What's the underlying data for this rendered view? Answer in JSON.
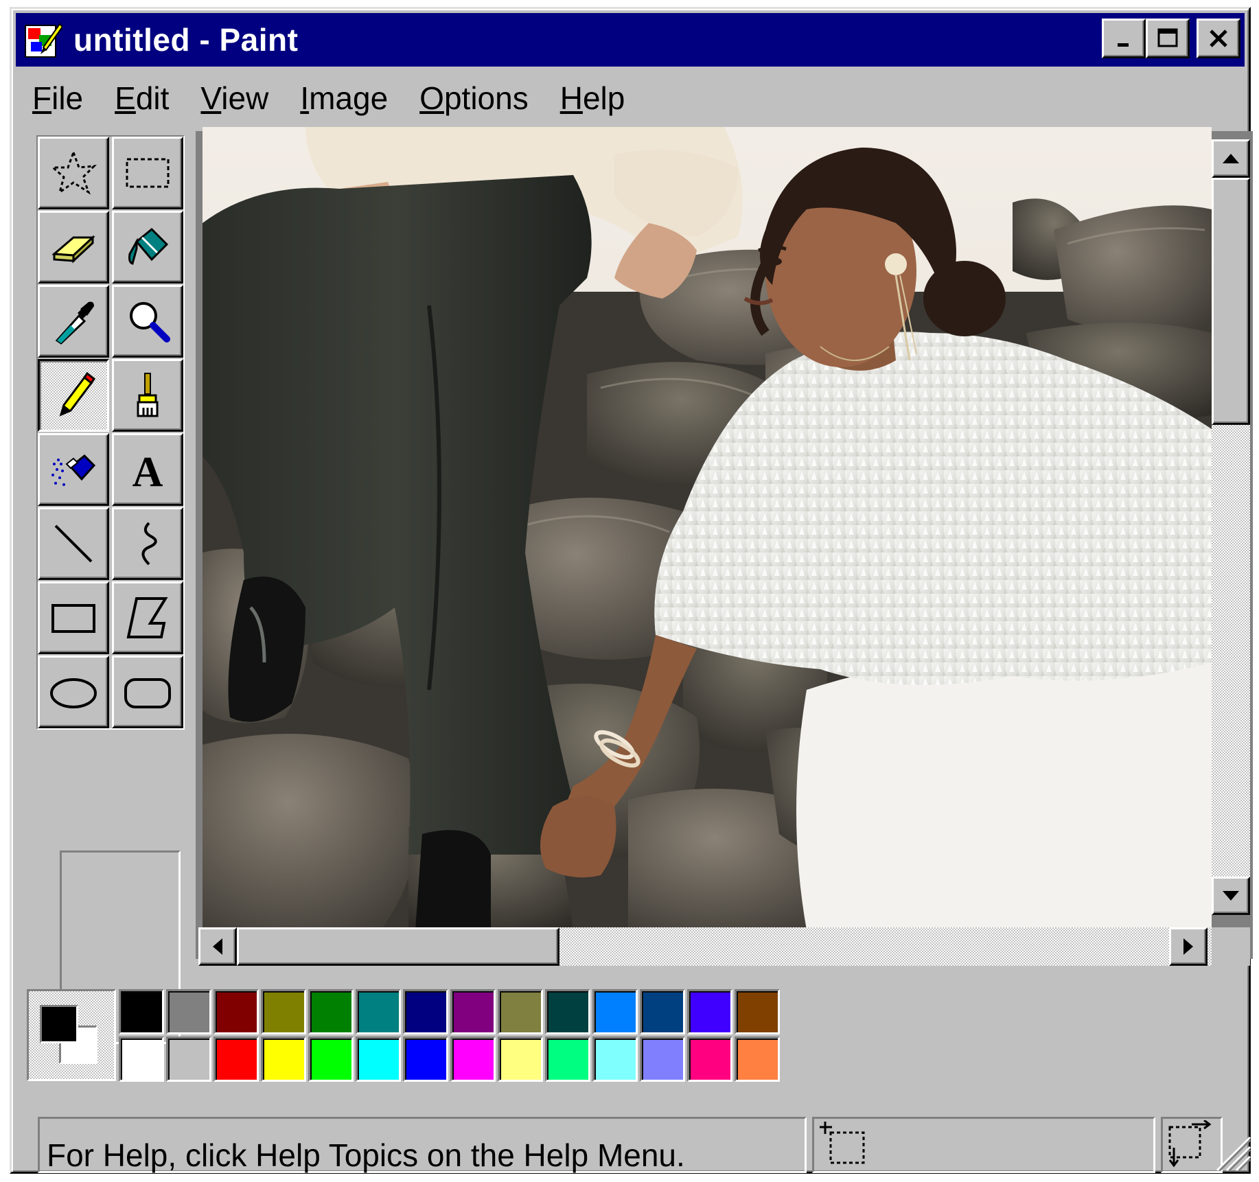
{
  "window": {
    "title": "untitled - Paint",
    "title_bar_color": "#000080",
    "face_color": "#c0c0c0"
  },
  "title_buttons": [
    {
      "name": "minimize-button",
      "icon": "minimize-icon"
    },
    {
      "name": "maximize-button",
      "icon": "maximize-icon"
    },
    {
      "name": "close-button",
      "icon": "close-icon"
    }
  ],
  "menu": [
    {
      "first": "F",
      "rest": "ile"
    },
    {
      "first": "E",
      "rest": "dit"
    },
    {
      "first": "V",
      "rest": "iew"
    },
    {
      "first": "I",
      "rest": "mage"
    },
    {
      "first": "O",
      "rest": "ptions"
    },
    {
      "first": "H",
      "rest": "elp"
    }
  ],
  "tools": [
    "free-form-select-icon",
    "select-icon",
    "eraser-icon",
    "fill-bucket-icon",
    "pick-color-icon",
    "magnifier-icon",
    "pencil-icon",
    "brush-icon",
    "airbrush-icon",
    "text-icon",
    "line-icon",
    "curve-icon",
    "rectangle-icon",
    "polygon-icon",
    "ellipse-icon",
    "rounded-rectangle-icon"
  ],
  "active_tool": "pencil-icon",
  "canvas": {
    "content": "photograph of a couple seated on dark rocks"
  },
  "colors": {
    "foreground": "#000000",
    "background": "#ffffff",
    "palette_top": [
      "#000000",
      "#808080",
      "#800000",
      "#808000",
      "#008000",
      "#008080",
      "#000080",
      "#800080",
      "#808040",
      "#004040",
      "#0080ff",
      "#004080",
      "#4000ff",
      "#804000"
    ],
    "palette_bottom": [
      "#ffffff",
      "#c0c0c0",
      "#ff0000",
      "#ffff00",
      "#00ff00",
      "#00ffff",
      "#0000ff",
      "#ff00ff",
      "#ffff80",
      "#00ff80",
      "#80ffff",
      "#8080ff",
      "#ff0080",
      "#ff8040"
    ]
  },
  "status": {
    "help_text": "For Help, click Help Topics on the Help Menu."
  }
}
